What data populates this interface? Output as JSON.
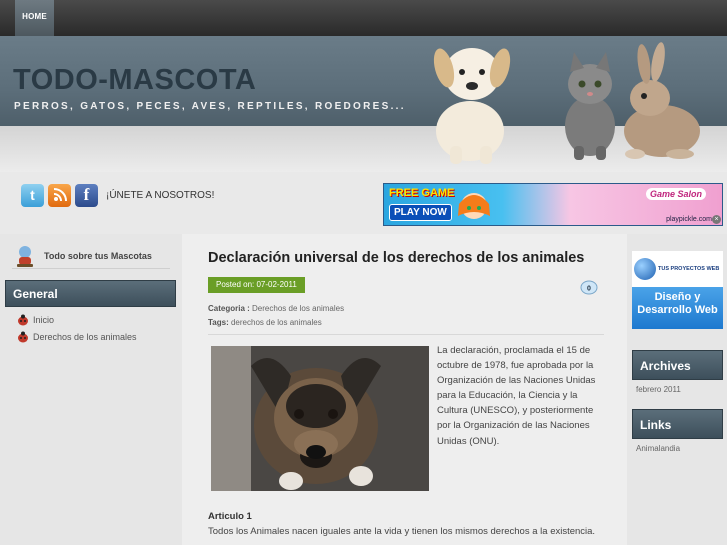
{
  "nav": {
    "home": "HOME"
  },
  "header": {
    "title": "TODO-MASCOTA",
    "tagline": "PERROS, GATOS, PECES, AVES, REPTILES, ROEDORES..."
  },
  "social": {
    "join_text": "¡ÚNETE A NOSOTROS!"
  },
  "ad_banner": {
    "headline": "FREE GAME",
    "cta": "PLAY NOW",
    "game_name": "Game Salon",
    "brand": "playpickle.com"
  },
  "left_sidebar": {
    "heading": "Todo sobre tus Mascotas",
    "section_title": "General",
    "items": [
      "Inicio",
      "Derechos de los animales"
    ]
  },
  "post": {
    "title": "Declaración universal de los derechos de los animales",
    "posted": "Posted on: 07-02-2011",
    "comment_count": "0",
    "category_label": "Categoria :",
    "category": "Derechos de los animales",
    "tags_label": "Tags:",
    "tags": "derechos de los animales",
    "body": "La declaración, proclamada el 15 de octubre de 1978, fue aprobada por la Organización de las Naciones Unidas para la Educación, la Ciencia y la Cultura (UNESCO), y posteriormente por la Organización de las Naciones Unidas (ONU).",
    "article_heading": "Articulo 1",
    "article_text": "Todos los Animales nacen iguales ante la vida y tienen los mismos derechos a la existencia."
  },
  "right_sidebar": {
    "ad": {
      "brand": "TUS PROYECTOS WEB",
      "line1": "Diseño y",
      "line2": "Desarrollo Web"
    },
    "archives_title": "Archives",
    "archives_items": [
      "febrero 2011"
    ],
    "links_title": "Links",
    "links_items": [
      "Animalandia"
    ]
  }
}
